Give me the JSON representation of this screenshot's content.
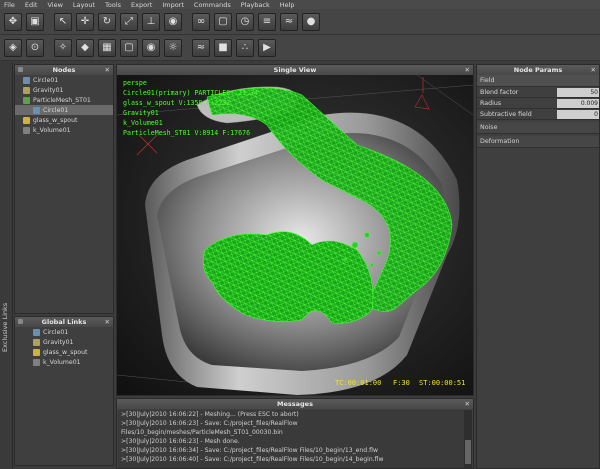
{
  "menu": [
    "File",
    "Edit",
    "View",
    "Layout",
    "Tools",
    "Export",
    "Import",
    "Commands",
    "Playback",
    "Help"
  ],
  "toolbar1": [
    "move-icon",
    "save-icon",
    "select-icon",
    "translate-icon",
    "rotate-icon",
    "scale-icon",
    "axis-icon",
    "camera-icon",
    "link-icon",
    "cube-icon",
    "timer-icon",
    "script-icon",
    "wave-icon",
    "sphere-icon"
  ],
  "toolbar2": [
    "node-icon",
    "emitter-icon",
    "daemon-icon",
    "object-icon",
    "mesh-icon",
    "cube-icon",
    "camera-icon",
    "light-icon",
    "wave-icon",
    "rigid-icon",
    "particle-icon",
    "simulate-icon"
  ],
  "side_strip": {
    "label": "Exclusive Links"
  },
  "nodes": {
    "title": "Nodes",
    "items": [
      {
        "label": "Circle01",
        "color": "#6a8fb0",
        "indent": 0
      },
      {
        "label": "Gravity01",
        "color": "#b0a060",
        "indent": 0
      },
      {
        "label": "ParticleMesh_ST01",
        "color": "#5fa04a",
        "indent": 0
      },
      {
        "label": "Circle01",
        "color": "#6a8fb0",
        "indent": 1,
        "selected": true
      },
      {
        "label": "glass_w_spout",
        "color": "#d0b040",
        "indent": 0
      },
      {
        "label": "k_Volume01",
        "color": "#808080",
        "indent": 0
      }
    ]
  },
  "global_links": {
    "title": "Global Links",
    "items": [
      {
        "label": "Circle01",
        "color": "#6a8fb0"
      },
      {
        "label": "Gravity01",
        "color": "#b0a060"
      },
      {
        "label": "glass_w_spout",
        "color": "#d0b040"
      },
      {
        "label": "k_Volume01",
        "color": "#808080"
      }
    ]
  },
  "view": {
    "title": "Single View",
    "overlay": [
      "Circle01(primary) PARTICLES: 21,34",
      "glass_w_spout V:1358 F:2232",
      "Gravity01",
      "k_Volume01",
      "ParticleMesh_ST01 V:8914 F:17676"
    ],
    "overlay_top": "perspe",
    "timecode": "TC:00:01:00",
    "frame": "F:30",
    "st": "ST:00:00:51"
  },
  "params": {
    "title": "Node Params",
    "section": "Field",
    "rows": [
      {
        "label": "Blend factor",
        "value": "50"
      },
      {
        "label": "Radius",
        "value": "0.009"
      },
      {
        "label": "Subtractive field",
        "value": "0"
      }
    ],
    "collapsed": [
      "Noise",
      "Deformation"
    ]
  },
  "messages": {
    "title": "Messages",
    "lines": [
      ">[30|July|2010 16:06:22] - Meshing... (Press ESC to abort)",
      ">[30|July|2010 16:06:23] - Save: C:/project_files/RealFlow",
      "Files/10_begin/meshes/ParticleMesh_ST01_00030.bin",
      ">[30|July|2010 16:06:23] - Mesh done.",
      ">[30|July|2010 16:06:34] - Save: C:/project_files/RealFlow Files/10_begin/13_end.flw",
      ">[30|July|2010 16:06:40] - Save: C:/project_files/RealFlow Files/10_begin/14_begin.flw"
    ]
  }
}
